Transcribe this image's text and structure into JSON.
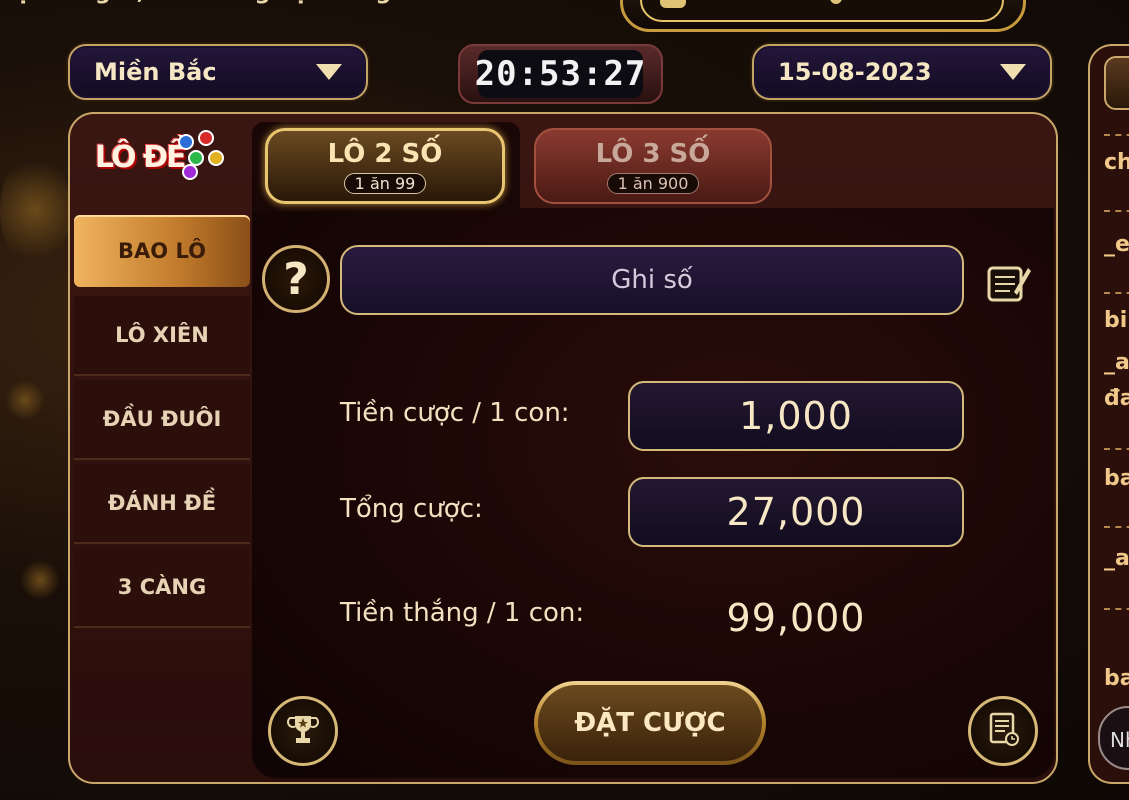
{
  "top_banner": {
    "text": "ược càng ít, khi thắng bạn càng thua nhiều"
  },
  "region_select": {
    "value": "Miền Bắc"
  },
  "timer": {
    "value": "20:53:27"
  },
  "date_select": {
    "value": "15-08-2023"
  },
  "logo": {
    "text": "LÔ ĐỀ"
  },
  "sidebar": {
    "items": [
      {
        "label": "BAO LÔ",
        "active": true
      },
      {
        "label": "LÔ XIÊN",
        "active": false
      },
      {
        "label": "ĐẦU ĐUÔI",
        "active": false
      },
      {
        "label": "ĐÁNH ĐỀ",
        "active": false
      },
      {
        "label": "3 CÀNG",
        "active": false
      }
    ]
  },
  "tabs": [
    {
      "title": "LÔ 2 SỐ",
      "sub": "1 ăn 99",
      "active": true
    },
    {
      "title": "LÔ 3 SỐ",
      "sub": "1 ăn 900",
      "active": false
    }
  ],
  "number_input": {
    "placeholder": "Ghi số"
  },
  "bet_per_unit": {
    "label": "Tiền cược / 1 con:",
    "value": "1,000"
  },
  "total_bet": {
    "label": "Tổng cược:",
    "value": "27,000"
  },
  "win_per_unit": {
    "label": "Tiền thắng / 1 con:",
    "value": "99,000"
  },
  "bet_button": {
    "label": "ĐẶT CƯỢC"
  },
  "right_panel": {
    "items": [
      "ch",
      "_e",
      "bi",
      "_a",
      "đa",
      "ba",
      "_a",
      "ba",
      "Nh"
    ]
  },
  "colors": {
    "gold": "#d4b97d",
    "accent": "#f0b45d",
    "background": "#1a0f08"
  },
  "icons": [
    "help-icon",
    "edit-icon",
    "trophy-icon",
    "history-icon",
    "chevron-down-icon"
  ]
}
